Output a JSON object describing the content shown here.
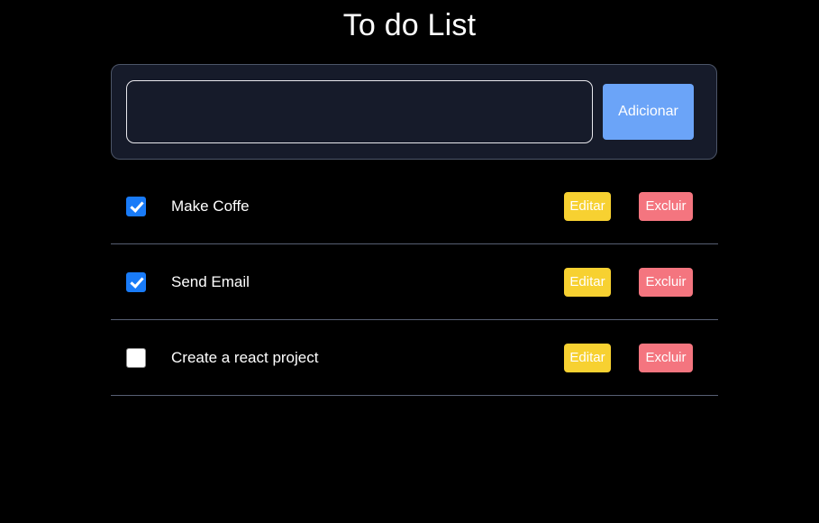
{
  "page": {
    "title": "To do List",
    "background_color": "#000000"
  },
  "add_form": {
    "input_value": "",
    "input_placeholder": "",
    "add_label": "Adicionar",
    "add_button_color": "#6ba4f8",
    "card_background": "#161b2a"
  },
  "buttons": {
    "edit_label": "Editar",
    "delete_label": "Excluir",
    "edit_color": "#f7d131",
    "delete_color": "#f4757f"
  },
  "tasks": [
    {
      "label": "Make Coffe",
      "done": true
    },
    {
      "label": "Send Email",
      "done": true
    },
    {
      "label": "Create a react project",
      "done": false
    }
  ]
}
